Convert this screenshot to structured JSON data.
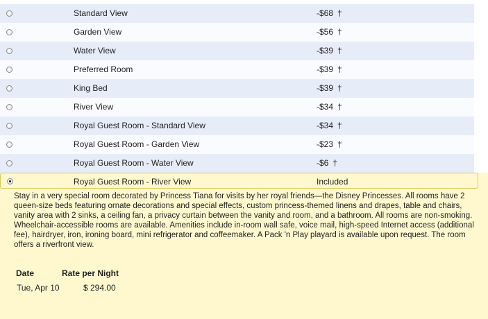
{
  "rooms": [
    {
      "name": "Standard View",
      "price": "-$68",
      "mark": "†"
    },
    {
      "name": "Garden View",
      "price": "-$56",
      "mark": "†"
    },
    {
      "name": "Water View",
      "price": "-$39",
      "mark": "†"
    },
    {
      "name": "Preferred Room",
      "price": "-$39",
      "mark": "†"
    },
    {
      "name": "King Bed",
      "price": "-$39",
      "mark": "†"
    },
    {
      "name": "River View",
      "price": "-$34",
      "mark": "†"
    },
    {
      "name": "Royal Guest Room - Standard View",
      "price": "-$34",
      "mark": "†"
    },
    {
      "name": "Royal Guest Room - Garden View",
      "price": "-$23",
      "mark": "†"
    },
    {
      "name": "Royal Guest Room - Water View",
      "price": "-$6",
      "mark": "†"
    }
  ],
  "selected": {
    "name": "Royal Guest Room - River View",
    "price": "Included",
    "description": "Stay in a very special room decorated by Princess Tiana for visits by her royal friends—the Disney Princesses. All rooms have 2 queen-size beds featuring ornate decorations and special effects, custom princess-themed linens and drapes, table and chairs, vanity area with 2 sinks, a ceiling fan, a privacy curtain between the vanity and room, and a bathroom. All rooms are non-smoking. Wheelchair-accessible rooms are available. Amenities include in-room wall safe, voice mail, high-speed Internet access (additional fee), hairdryer, iron, ironing board, mini refrigerator and coffeemaker. A Pack 'n Play playard is available upon request. The room offers a riverfront view.",
    "rates": {
      "date_header": "Date",
      "rate_header": "Rate per Night",
      "date": "Tue, Apr 10",
      "rate": "$ 294.00"
    }
  },
  "colors": {
    "alt_row": "#e6edf9",
    "selected_bg": "#fff8cf",
    "selected_border": "#d9c458"
  }
}
